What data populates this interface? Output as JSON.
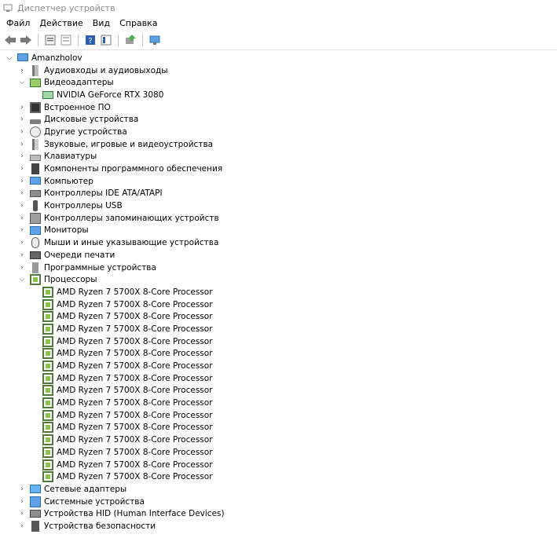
{
  "window": {
    "title": "Диспетчер устройств"
  },
  "menu": [
    "Файл",
    "Действие",
    "Вид",
    "Справка"
  ],
  "toolbar": [
    "back-icon",
    "forward-icon",
    "properties-icon",
    "refresh-icon",
    "help-icon",
    "view-icon",
    "update-driver-icon",
    "scan-icon"
  ],
  "tree": {
    "root": "Amanzholov",
    "categories": [
      {
        "label": "Аудиовходы и аудиовыходы",
        "icon": "audio-icon",
        "expanded": false
      },
      {
        "label": "Видеоадаптеры",
        "icon": "display-adapter-icon",
        "expanded": true,
        "children": [
          "NVIDIA GeForce RTX 3080"
        ]
      },
      {
        "label": "Встроенное ПО",
        "icon": "firmware-icon",
        "expanded": false
      },
      {
        "label": "Дисковые устройства",
        "icon": "disk-icon",
        "expanded": false
      },
      {
        "label": "Другие устройства",
        "icon": "other-device-icon",
        "expanded": false
      },
      {
        "label": "Звуковые, игровые и видеоустройства",
        "icon": "sound-icon",
        "expanded": false
      },
      {
        "label": "Клавиатуры",
        "icon": "keyboard-icon",
        "expanded": false
      },
      {
        "label": "Компоненты программного обеспечения",
        "icon": "software-component-icon",
        "expanded": false
      },
      {
        "label": "Компьютер",
        "icon": "computer-icon",
        "expanded": false
      },
      {
        "label": "Контроллеры IDE ATA/ATAPI",
        "icon": "ide-controller-icon",
        "expanded": false
      },
      {
        "label": "Контроллеры USB",
        "icon": "usb-icon",
        "expanded": false
      },
      {
        "label": "Контроллеры запоминающих устройств",
        "icon": "storage-controller-icon",
        "expanded": false
      },
      {
        "label": "Мониторы",
        "icon": "monitor-icon",
        "expanded": false
      },
      {
        "label": "Мыши и иные указывающие устройства",
        "icon": "mouse-icon",
        "expanded": false
      },
      {
        "label": "Очереди печати",
        "icon": "print-queue-icon",
        "expanded": false
      },
      {
        "label": "Программные устройства",
        "icon": "software-device-icon",
        "expanded": false
      },
      {
        "label": "Процессоры",
        "icon": "processor-icon",
        "expanded": true,
        "children": [
          "AMD Ryzen 7 5700X 8-Core Processor",
          "AMD Ryzen 7 5700X 8-Core Processor",
          "AMD Ryzen 7 5700X 8-Core Processor",
          "AMD Ryzen 7 5700X 8-Core Processor",
          "AMD Ryzen 7 5700X 8-Core Processor",
          "AMD Ryzen 7 5700X 8-Core Processor",
          "AMD Ryzen 7 5700X 8-Core Processor",
          "AMD Ryzen 7 5700X 8-Core Processor",
          "AMD Ryzen 7 5700X 8-Core Processor",
          "AMD Ryzen 7 5700X 8-Core Processor",
          "AMD Ryzen 7 5700X 8-Core Processor",
          "AMD Ryzen 7 5700X 8-Core Processor",
          "AMD Ryzen 7 5700X 8-Core Processor",
          "AMD Ryzen 7 5700X 8-Core Processor",
          "AMD Ryzen 7 5700X 8-Core Processor",
          "AMD Ryzen 7 5700X 8-Core Processor"
        ]
      },
      {
        "label": "Сетевые адаптеры",
        "icon": "network-adapter-icon",
        "expanded": false
      },
      {
        "label": "Системные устройства",
        "icon": "system-device-icon",
        "expanded": false
      },
      {
        "label": "Устройства HID (Human Interface Devices)",
        "icon": "hid-icon",
        "expanded": false
      },
      {
        "label": "Устройства безопасности",
        "icon": "security-device-icon",
        "expanded": false
      }
    ]
  }
}
